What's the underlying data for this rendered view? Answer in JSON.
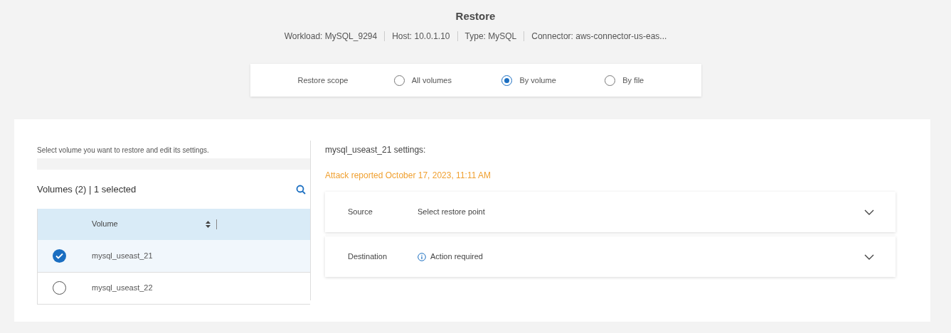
{
  "title": "Restore",
  "meta": [
    "Workload: MySQL_9294",
    "Host: 10.0.1.10",
    "Type: MySQL",
    "Connector: aws-connector-us-eas..."
  ],
  "scope": {
    "label": "Restore scope",
    "options": [
      {
        "label": "All volumes",
        "selected": false
      },
      {
        "label": "By volume",
        "selected": true
      },
      {
        "label": "By file",
        "selected": false
      }
    ]
  },
  "volumes": {
    "instruction": "Select volume you want to restore and edit its settings.",
    "heading": "Volumes (2) | 1 selected",
    "column": "Volume",
    "rows": [
      {
        "name": "mysql_useast_21",
        "selected": true
      },
      {
        "name": "mysql_useast_22",
        "selected": false
      }
    ]
  },
  "settings": {
    "title": "mysql_useast_21 settings:",
    "alert": "Attack reported October 17, 2023, 11:11 AM",
    "sections": [
      {
        "label": "Source",
        "kind": "plain",
        "value": "Select restore point",
        "expanded": false
      },
      {
        "label": "Destination",
        "kind": "notice",
        "value": "Action required",
        "expanded": false
      }
    ]
  }
}
